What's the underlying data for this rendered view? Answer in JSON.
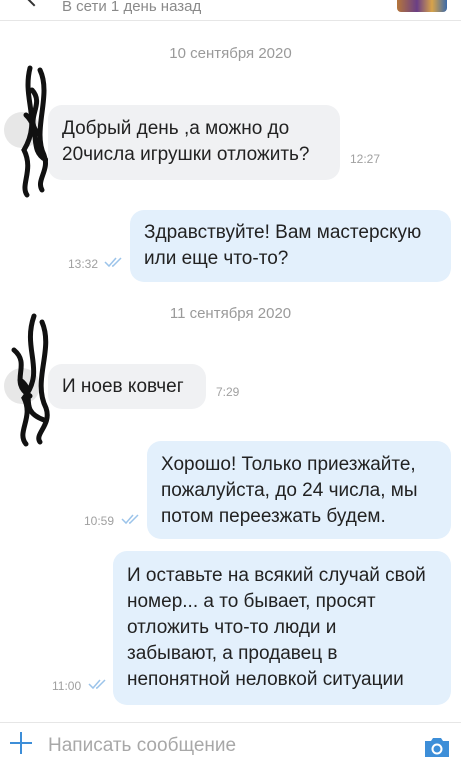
{
  "header": {
    "status": "В сети 1 день назад"
  },
  "dates": [
    "10 сентября 2020",
    "11 сентября 2020"
  ],
  "messages": [
    {
      "direction": "in",
      "lines": [
        "Добрый день ,а можно до",
        "20числа игрушки отложить?"
      ],
      "time": "12:27"
    },
    {
      "direction": "out",
      "lines": [
        "Здравствуйте! Вам мастерскую",
        "или еще что-то?"
      ],
      "time": "13:32",
      "read": true
    },
    {
      "direction": "in",
      "lines": [
        "И ноев ковчег"
      ],
      "time": "7:29"
    },
    {
      "direction": "out",
      "lines": [
        "Хорошо! Только приезжайте,",
        "пожалуйста, до 24 числа, мы",
        "потом переезжать будем."
      ],
      "time": "10:59",
      "read": true
    },
    {
      "direction": "out",
      "lines": [
        "И оставьте на всякий случай свой",
        "номер... а то бывает, просят",
        "отложить что-то люди и",
        "забывают, а продавец в",
        "непонятной неловкой ситуации"
      ],
      "time": "11:00",
      "read": true
    }
  ],
  "composer": {
    "placeholder": "Написать сообщение"
  },
  "icons": {
    "attach": "plus-icon",
    "camera": "camera-icon",
    "back": "back-arrow-icon",
    "read": "double-check-icon"
  },
  "colors": {
    "accent": "#3d8ed8",
    "incoming_bubble": "#f0f1f3",
    "outgoing_bubble": "#e3f0fc"
  }
}
